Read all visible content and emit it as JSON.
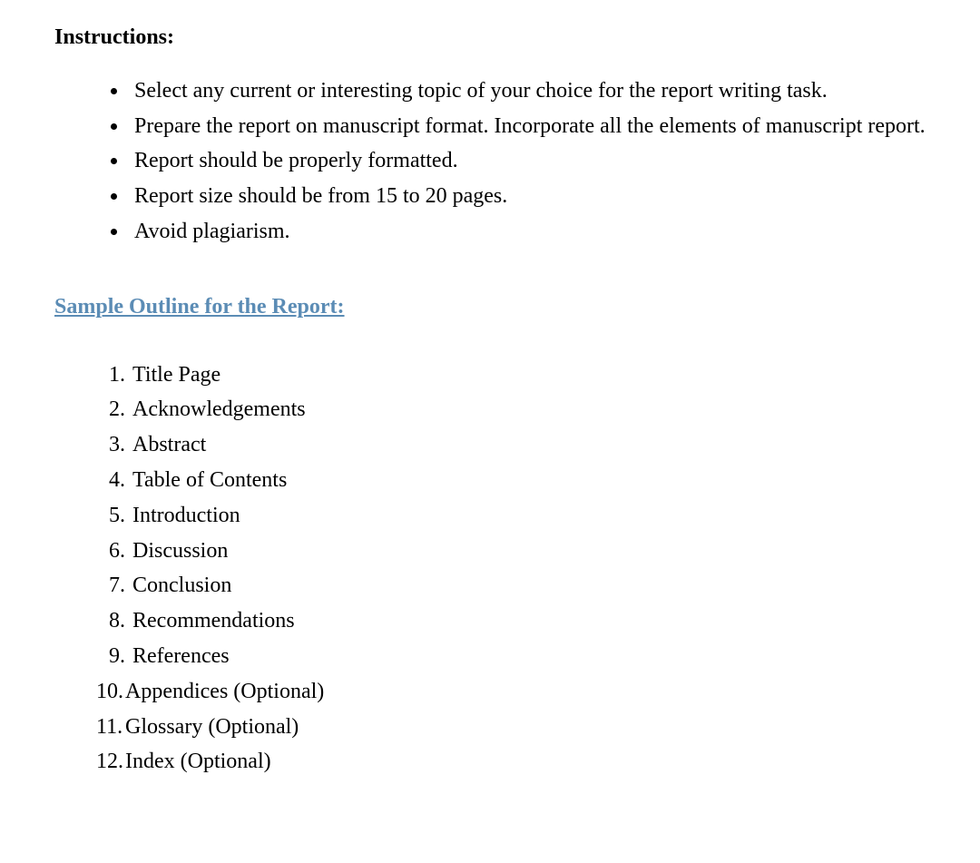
{
  "instructions_heading": "Instructions:",
  "instructions": [
    "Select any current or interesting topic of your choice for the report writing task.",
    "Prepare the report on manuscript format. Incorporate all the elements of manuscript report.",
    "Report should be properly formatted.",
    "Report size should be from 15 to 20 pages.",
    "Avoid plagiarism."
  ],
  "sample_heading": "Sample Outline for the Report:",
  "outline": [
    {
      "number": "1.",
      "label": "Title Page"
    },
    {
      "number": "2.",
      "label": "Acknowledgements"
    },
    {
      "number": "3.",
      "label": "Abstract"
    },
    {
      "number": "4.",
      "label": "Table of Contents"
    },
    {
      "number": "5.",
      "label": "Introduction"
    },
    {
      "number": "6.",
      "label": "Discussion"
    },
    {
      "number": "7.",
      "label": "Conclusion"
    },
    {
      "number": "8.",
      "label": "Recommendations"
    },
    {
      "number": "9.",
      "label": "References"
    },
    {
      "number": "10.",
      "label": "Appendices (Optional)"
    },
    {
      "number": "11.",
      "label": "Glossary (Optional)"
    },
    {
      "number": "12.",
      "label": "Index (Optional)"
    }
  ]
}
